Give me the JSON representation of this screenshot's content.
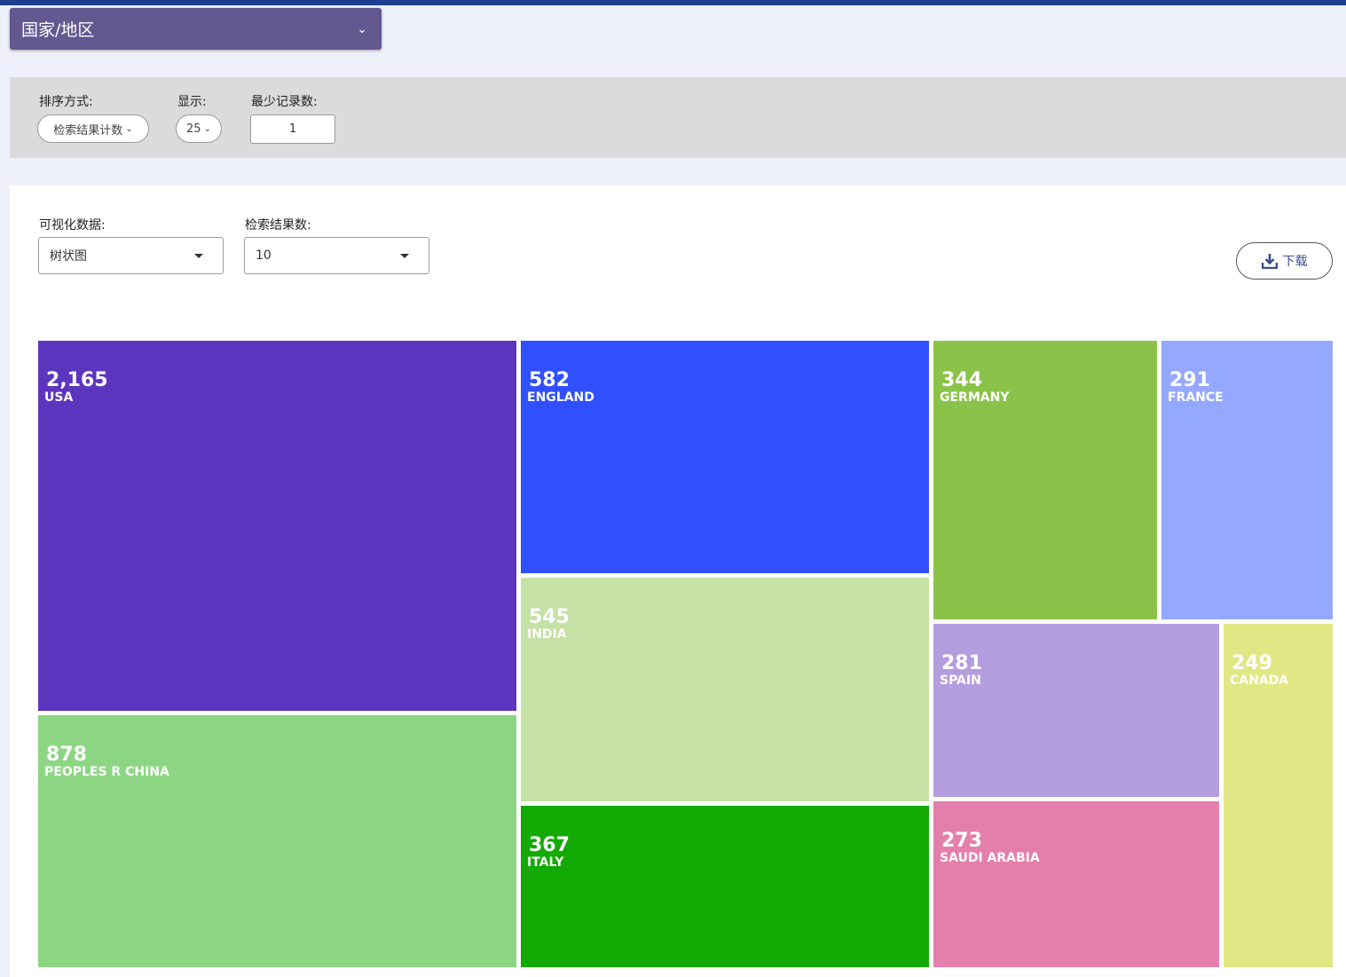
{
  "panel": {
    "title": "国家/地区",
    "chevron_icon": "chevron-down-icon"
  },
  "filters": {
    "sort_label": "排序方式:",
    "sort_value": "检索结果计数",
    "show_label": "显示:",
    "show_value": "25",
    "min_label": "最少记录数:",
    "min_value": "1"
  },
  "visualization": {
    "data_label": "可视化数据:",
    "data_value": "树状图",
    "count_label": "检索结果数:",
    "count_value": "10",
    "download_label": "下载",
    "download_icon": "download-icon"
  },
  "chart_data": {
    "type": "treemap",
    "title": "",
    "items": [
      {
        "label": "USA",
        "value": 2165,
        "value_text": "2,165",
        "color": "#5c35be"
      },
      {
        "label": "PEOPLES R CHINA",
        "value": 878,
        "value_text": "878",
        "color": "#8cd683"
      },
      {
        "label": "ENGLAND",
        "value": 582,
        "value_text": "582",
        "color": "#3050ff"
      },
      {
        "label": "INDIA",
        "value": 545,
        "value_text": "545",
        "color": "#c5e1a5"
      },
      {
        "label": "ITALY",
        "value": 367,
        "value_text": "367",
        "color": "#14aa05"
      },
      {
        "label": "GERMANY",
        "value": 344,
        "value_text": "344",
        "color": "#8bc34a"
      },
      {
        "label": "FRANCE",
        "value": 291,
        "value_text": "291",
        "color": "#95a8ff"
      },
      {
        "label": "SPAIN",
        "value": 281,
        "value_text": "281",
        "color": "#b39ddf"
      },
      {
        "label": "SAUDI ARABIA",
        "value": 273,
        "value_text": "273",
        "color": "#e47fac"
      },
      {
        "label": "CANADA",
        "value": 249,
        "value_text": "249",
        "color": "#e1e784"
      }
    ]
  }
}
